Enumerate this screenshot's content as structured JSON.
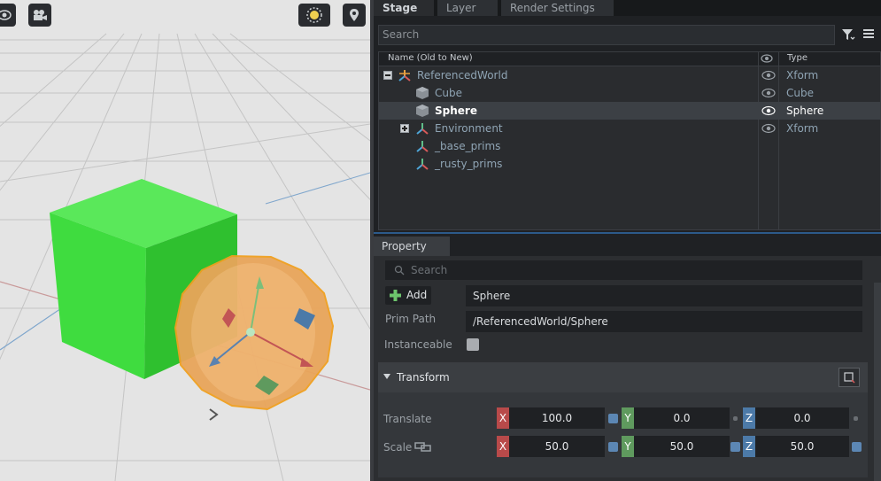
{
  "viewport": {
    "buttons": [
      {
        "icon": "eye-icon"
      },
      {
        "icon": "camera-icon"
      },
      {
        "icon": "sun-icon"
      },
      {
        "icon": "map-pin-icon"
      }
    ],
    "colors": {
      "background": "#e4e4e4",
      "cube": "#3fdc3f",
      "sphere": "#e9a55a",
      "selection": "#f0a020"
    }
  },
  "stage": {
    "tabs": [
      {
        "label": "Stage",
        "active": true
      },
      {
        "label": "Layer",
        "active": false
      },
      {
        "label": "Render Settings",
        "active": false
      }
    ],
    "search_placeholder": "Search",
    "columns": {
      "name": "Name (Old to New)",
      "type": "Type"
    },
    "rows": [
      {
        "name": "ReferencedWorld",
        "type": "Xform",
        "icon": "xform-icon",
        "expander": "minus",
        "visible": true,
        "selected": false
      },
      {
        "name": "Cube",
        "type": "Cube",
        "icon": "mesh-icon",
        "expander": "",
        "visible": true,
        "selected": false
      },
      {
        "name": "Sphere",
        "type": "Sphere",
        "icon": "mesh-icon",
        "expander": "",
        "visible": true,
        "selected": true
      },
      {
        "name": "Environment",
        "type": "Xform",
        "icon": "xform-icon",
        "expander": "plus",
        "visible": true,
        "selected": false
      },
      {
        "name": "_base_prims",
        "type": "",
        "icon": "xform-icon",
        "expander": "",
        "visible": false,
        "selected": false
      },
      {
        "name": "_rusty_prims",
        "type": "",
        "icon": "xform-icon",
        "expander": "",
        "visible": false,
        "selected": false
      }
    ]
  },
  "property": {
    "tab": "Property",
    "search_placeholder": "Search",
    "add_label": "Add",
    "prim_name": "Sphere",
    "prim_path_label": "Prim Path",
    "prim_path": "/ReferencedWorld/Sphere",
    "instanceable_label": "Instanceable",
    "transform": {
      "title": "Transform",
      "translate": {
        "label": "Translate",
        "x": "100.0",
        "y": "0.0",
        "z": "0.0"
      },
      "scale": {
        "label": "Scale",
        "x": "50.0",
        "y": "50.0",
        "z": "50.0"
      }
    }
  }
}
